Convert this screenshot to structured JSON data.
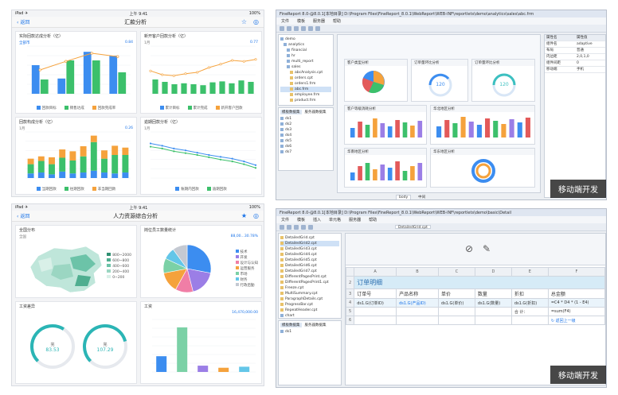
{
  "tl": {
    "status_left": "iPad ✈",
    "status_time": "上午 9:41",
    "status_right": "100%",
    "back": "返回",
    "title": "汇款分析",
    "c1": {
      "title": "实际回款达成分析（亿）",
      "sub_left": "全部市",
      "sub_right": "0.84",
      "categories": [
        "1季度",
        "2季度",
        "3季度",
        "4季度"
      ],
      "bar_a": [
        60,
        32,
        88,
        80
      ],
      "bar_b": [
        30,
        70,
        70,
        45
      ],
      "line": [
        50,
        68,
        85,
        78
      ],
      "legend": [
        "回款目标",
        "销售达成",
        "回款完成率"
      ]
    },
    "c2": {
      "title": "新开客户回款分析（亿）",
      "sub_left": "1月",
      "sub_right": "0.77",
      "line_a": [
        48,
        40,
        38,
        42,
        45,
        55,
        62,
        70,
        68,
        72
      ],
      "bar_b": [
        30,
        25,
        20,
        22,
        20,
        18,
        24,
        26,
        22,
        28,
        25
      ],
      "legend": [
        "累计目标",
        "累计完成",
        "新开客户回款"
      ]
    },
    "c3": {
      "title": "回款构成分析（亿）",
      "sub_left": "1月",
      "sub_right": "0.26",
      "stack_a": [
        10,
        12,
        8,
        14,
        10,
        12,
        16,
        12,
        10,
        12
      ],
      "stack_b": [
        20,
        25,
        22,
        30,
        28,
        35,
        62,
        30,
        40,
        38
      ],
      "stack_c": [
        12,
        10,
        15,
        18,
        20,
        22,
        14,
        18,
        20,
        16
      ],
      "legend": [
        "当期回款",
        "往期回款",
        "非当期回款"
      ]
    },
    "c4": {
      "title": "逾期回款分析（亿）",
      "sub_left": "1月",
      "line_a": [
        75,
        70,
        64,
        60,
        55,
        50,
        46,
        42,
        36,
        28
      ],
      "line_b": [
        68,
        64,
        58,
        54,
        50,
        45,
        40,
        36,
        30,
        22
      ],
      "legend": [
        "账期内回款",
        "逾期回款"
      ]
    }
  },
  "bl": {
    "back": "返回",
    "title": "人力资源综合分析",
    "c1": {
      "title": "全国分布",
      "sub": "全国",
      "legend": [
        "800~2000",
        "600~800",
        "400~600",
        "200~400",
        "0~200"
      ]
    },
    "c2": {
      "title": "岗位员工数量统计",
      "sub_right": "88,00...30.78%",
      "legend": [
        "技术",
        "开发",
        "设计与认知",
        "运营服务",
        "市场",
        "财务",
        "行政后勤"
      ],
      "slices": [
        28,
        18,
        12,
        14,
        10,
        8,
        10
      ]
    },
    "c3": {
      "title": "工资差异",
      "g1_label": "完",
      "g1_value": "83.53",
      "g2_label": "完",
      "g2_value": "107.29",
      "g1_pct": 0.62,
      "g2_pct": 0.78
    },
    "c4": {
      "title": "工资",
      "sub_right": "16,470,000.00",
      "values": [
        30,
        85,
        12,
        8,
        10
      ]
    }
  },
  "tr": {
    "title": "FineReport 8.0-@8.0.1[本地目录]   D:\\Program Files\\FineReport_8.0.1\\WebReport\\WEB-INF\\reportlets\\demo\\analytics\\sales\\abc.frm",
    "menu": [
      "文件",
      "模板",
      "服务器",
      "帮助"
    ],
    "tree": [
      "demo",
      "analytics",
      "financial",
      "hr",
      "multi_report",
      "sales",
      "abcAnalysis.cpt",
      "orders.cpt",
      "orders1.frm",
      "abc.frm",
      "employee.frm",
      "product.frm",
      "orders.frm",
      "test",
      "ProductAlert.cpt",
      "product.cpt"
    ],
    "tabs": [
      "模板数据集",
      "服务器数据集"
    ],
    "datasets": [
      "ds1",
      "ds2",
      "ds3",
      "ds4",
      "ds5",
      "ds6",
      "ds7"
    ],
    "cards": [
      "客户类型分析",
      "订单量环比分析",
      "客户等级消耗分析",
      "华北地区分析",
      "华南地区分析",
      "华东地区分析"
    ],
    "gauge1": "120",
    "gauge2": "120",
    "props": [
      [
        "属性名",
        "属性值"
      ],
      [
        "组件名",
        "adaptive"
      ],
      [
        "布局",
        "普通"
      ],
      [
        "内边距",
        "2,0,1,0"
      ],
      [
        "组件间距",
        "0"
      ],
      [
        "移动端",
        "手机"
      ]
    ],
    "badge": "移动端开发",
    "bottom_tabs": [
      "body",
      "中间"
    ]
  },
  "br": {
    "title": "FineReport 8.0-@8.0.1[本地目录]   D:\\Program Files\\FineReport_8.0.1\\WebReport\\WEB-INF\\reportlets\\demo\\basic\\Detail",
    "menu": [
      "文件",
      "模板",
      "插入",
      "单元格",
      "服务器",
      "帮助"
    ],
    "file_tab": "DetailedGrid.cpt",
    "tree": [
      "DetailedGrid.cpt",
      "DetailedGrid2.cpt",
      "DetailedGrid3.cpt",
      "DetailedGrid4.cpt",
      "DetailedGrid5.cpt",
      "DetailedGrid6.cpt",
      "DetailedGrid7.cpt",
      "DifferentPagesPrint.cpt",
      "DifferentPagesPrint1.cpt",
      "Freeze.cpt",
      "MultiSummary.cpt",
      "ParagraphDetails.cpt",
      "ProgressBar.cpt",
      "RepeatHeader.cpt",
      "chart"
    ],
    "tabs": [
      "模板数据集",
      "服务器数据集"
    ],
    "datasets": [
      "ds1"
    ],
    "col_headers": [
      "A",
      "B",
      "C",
      "D",
      "E",
      "F"
    ],
    "row_headers": [
      "1",
      "2",
      "3",
      "4",
      "5",
      "6"
    ],
    "sheet_title": "订单明细",
    "headers": [
      "订单号",
      "产品名称",
      "单价",
      "数量",
      "折扣",
      "总金额"
    ],
    "row4": [
      "ds1.G(订单ID)",
      "ds1.G(产品ID)",
      "ds1.G(单价)",
      "ds1.G(数量)",
      "ds1.G(折扣)",
      "=C4 * D4 * (1 - E4)"
    ],
    "row5": [
      "",
      "",
      "",
      "",
      "合 计：",
      "=sum(F4)"
    ],
    "link": "返回上一级",
    "badge": "移动端开发"
  }
}
